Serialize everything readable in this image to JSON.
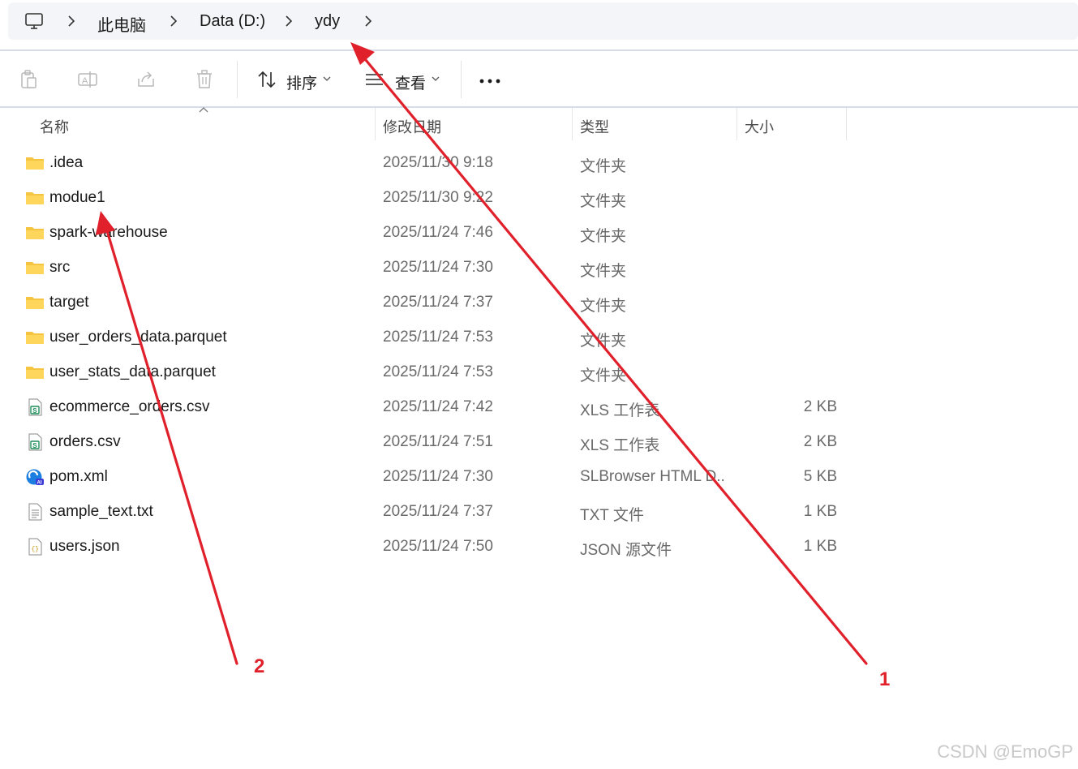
{
  "breadcrumb": {
    "icon": "computer-icon",
    "items": [
      "此电脑",
      "Data (D:)",
      "ydy"
    ]
  },
  "toolbar": {
    "buttons": [
      "paste-icon",
      "rename-icon",
      "share-icon",
      "delete-icon"
    ],
    "sort_label": "排序",
    "view_label": "查看",
    "more_icon": "more-icon"
  },
  "columns": {
    "name": "名称",
    "date": "修改日期",
    "type": "类型",
    "size": "大小"
  },
  "files": [
    {
      "name": ".idea",
      "date": "2025/11/30 9:18",
      "type": "文件夹",
      "size": "",
      "icon": "folder-icon"
    },
    {
      "name": "modue1",
      "date": "2025/11/30 9:22",
      "type": "文件夹",
      "size": "",
      "icon": "folder-icon"
    },
    {
      "name": "spark-warehouse",
      "date": "2025/11/24 7:46",
      "type": "文件夹",
      "size": "",
      "icon": "folder-icon"
    },
    {
      "name": "src",
      "date": "2025/11/24 7:30",
      "type": "文件夹",
      "size": "",
      "icon": "folder-icon"
    },
    {
      "name": "target",
      "date": "2025/11/24 7:37",
      "type": "文件夹",
      "size": "",
      "icon": "folder-icon"
    },
    {
      "name": "user_orders_data.parquet",
      "date": "2025/11/24 7:53",
      "type": "文件夹",
      "size": "",
      "icon": "folder-icon"
    },
    {
      "name": "user_stats_data.parquet",
      "date": "2025/11/24 7:53",
      "type": "文件夹",
      "size": "",
      "icon": "folder-icon"
    },
    {
      "name": "ecommerce_orders.csv",
      "date": "2025/11/24 7:42",
      "type": "XLS 工作表",
      "size": "2 KB",
      "icon": "spreadsheet-icon"
    },
    {
      "name": "orders.csv",
      "date": "2025/11/24 7:51",
      "type": "XLS 工作表",
      "size": "2 KB",
      "icon": "spreadsheet-icon"
    },
    {
      "name": "pom.xml",
      "date": "2025/11/24 7:30",
      "type": "SLBrowser HTML D...",
      "size": "5 KB",
      "icon": "browser-icon"
    },
    {
      "name": "sample_text.txt",
      "date": "2025/11/24 7:37",
      "type": "TXT 文件",
      "size": "1 KB",
      "icon": "text-file-icon"
    },
    {
      "name": "users.json",
      "date": "2025/11/24 7:50",
      "type": "JSON 源文件",
      "size": "1 KB",
      "icon": "json-file-icon"
    }
  ],
  "annotations": {
    "label_1": "1",
    "label_2": "2",
    "color": "#e0202a"
  },
  "watermark": "CSDN @EmoGP"
}
